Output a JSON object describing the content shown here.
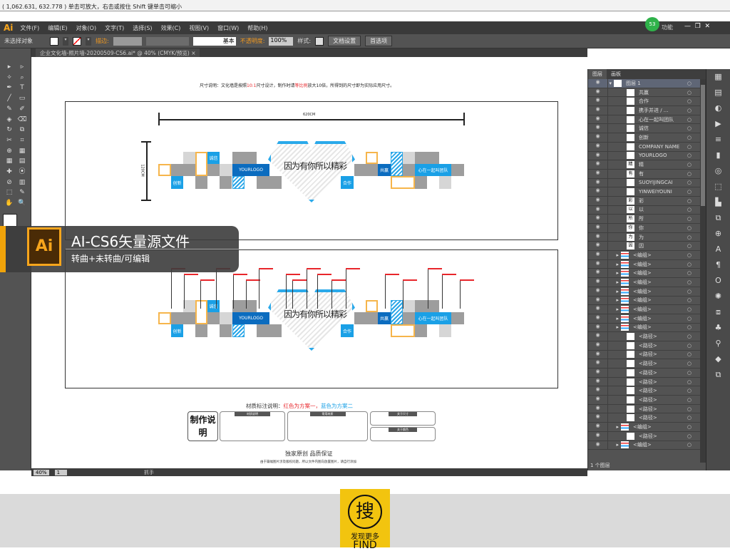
{
  "status": {
    "coords": "( 1,062.631, 632.778 ) 单击可放大，右击或按住 Shift 键单击可缩小"
  },
  "menu": {
    "logo": "Ai",
    "items": [
      "文件(F)",
      "编辑(E)",
      "对象(O)",
      "文字(T)",
      "选择(S)",
      "效果(C)",
      "视图(V)",
      "窗口(W)",
      "帮助(H)"
    ],
    "workspace": "功能",
    "badge": "53"
  },
  "control": {
    "selection": "未选择对象",
    "stroke_label": "描边:",
    "brush": "基本",
    "opacity_label": "不透明度:",
    "opacity": "100%",
    "style_label": "样式:",
    "doc_setup": "文档设置",
    "prefs": "首选项"
  },
  "document": {
    "tab": "企业文化墙-照片墙-20200509-CS6.ai* @ 40% (CMYK/预览)",
    "close": "×"
  },
  "design": {
    "size_note_a": "尺寸说明：文化墙是按照",
    "size_note_ratio": "10:1",
    "size_note_b": "尺寸设计，制作时请",
    "size_note_scale": "等比例",
    "size_note_c": "放大10倍，所得到的尺寸即为实际应用尺寸。",
    "width_dim": "620CM",
    "height_dim": "120CM",
    "labels": {
      "chengxin": "诚信",
      "chuangxin": "创新",
      "logo": "YOURLOGO",
      "hezuo": "合作",
      "gongying": "共赢",
      "team": "心在一起叫团队"
    },
    "heart_text": "因为有你所以精彩",
    "material_title": "材质标注说明：",
    "material_red": "红色为方案一，",
    "material_blue": "蓝色为方案二",
    "make_title": "制作说明",
    "card_titles": [
      "材质说明",
      "常用材质",
      "关于尺寸",
      "关于颜色"
    ],
    "original": "独家原创 品质保证",
    "original_note": "由于篇幅图片涉及版权问题，所以文件内图向放置图片，请自行添加"
  },
  "banner": {
    "icon": "Ai",
    "title": "AI-CS6矢量源文件",
    "subtitle": "转曲+未转曲/可编辑"
  },
  "layers": {
    "tabs": [
      "图层",
      "画板"
    ],
    "rows": [
      {
        "name": "图层 1",
        "thumb": "",
        "top": true
      },
      {
        "name": "共赢"
      },
      {
        "name": "合作"
      },
      {
        "name": "携手并进 / ..."
      },
      {
        "name": "心在一起叫团队"
      },
      {
        "name": "诚信"
      },
      {
        "name": "创新"
      },
      {
        "name": "COMPANY NAME"
      },
      {
        "name": "YOURLOGO"
      },
      {
        "name": "精",
        "thumb": "精"
      },
      {
        "name": "有",
        "thumb": "有"
      },
      {
        "name": "SUOYIJINGCAI"
      },
      {
        "name": "YINWEIYOUNI"
      },
      {
        "name": "彩",
        "thumb": "彩"
      },
      {
        "name": "以",
        "thumb": "以"
      },
      {
        "name": "所",
        "thumb": "所"
      },
      {
        "name": "你",
        "thumb": "你"
      },
      {
        "name": "为",
        "thumb": "为"
      },
      {
        "name": "因",
        "thumb": "因"
      },
      {
        "name": "<编组>",
        "group": true
      },
      {
        "name": "<编组>",
        "group": true
      },
      {
        "name": "<编组>",
        "group": true
      },
      {
        "name": "<编组>",
        "group": true
      },
      {
        "name": "<编组>",
        "group": true
      },
      {
        "name": "<编组>",
        "group": true
      },
      {
        "name": "<编组>",
        "group": true
      },
      {
        "name": "<编组>",
        "group": true
      },
      {
        "name": "<编组>",
        "group": true
      },
      {
        "name": "<路径>"
      },
      {
        "name": "<路径>"
      },
      {
        "name": "<路径>"
      },
      {
        "name": "<路径>"
      },
      {
        "name": "<路径>"
      },
      {
        "name": "<路径>"
      },
      {
        "name": "<路径>"
      },
      {
        "name": "<路径>"
      },
      {
        "name": "<路径>"
      },
      {
        "name": "<路径>"
      },
      {
        "name": "<编组>",
        "group": true
      },
      {
        "name": "<路径>"
      },
      {
        "name": "<编组>",
        "group": true
      }
    ],
    "count": "1 个图层"
  },
  "statusbar": {
    "zoom": "40%",
    "page": "1",
    "tool": "抓手"
  },
  "find": {
    "icon_char": "搜",
    "text": "发现更多",
    "en": "FIND"
  },
  "colors": {
    "accent": "#f49a1e",
    "blue": "#1aa0e6",
    "dark_blue": "#0b6cbf",
    "red": "#e8262b"
  }
}
